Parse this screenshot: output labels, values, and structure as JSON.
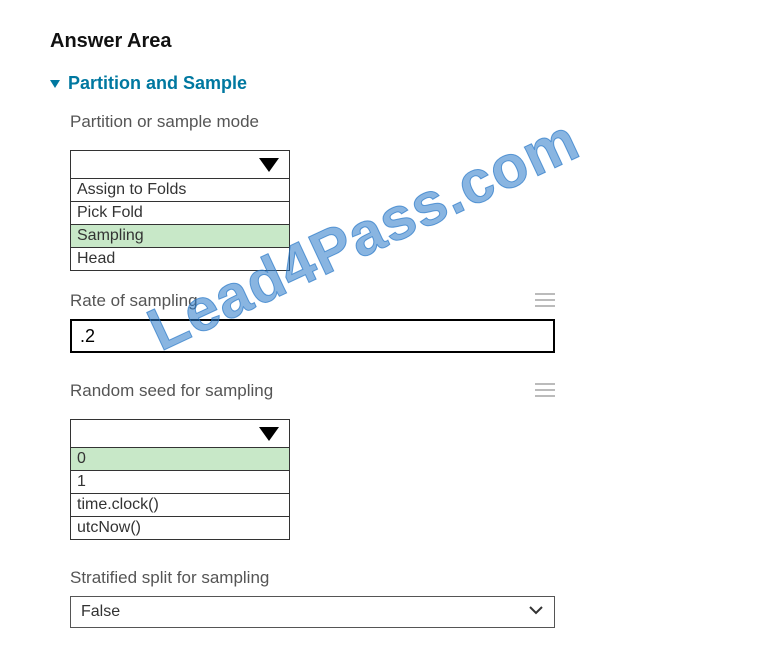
{
  "title": "Answer Area",
  "section": {
    "header": "Partition and Sample"
  },
  "mode": {
    "label": "Partition or sample mode",
    "options": [
      "Assign to Folds",
      "Pick Fold",
      "Sampling",
      "Head"
    ],
    "selected_index": 2
  },
  "rate": {
    "label": "Rate of sampling",
    "value": ".2"
  },
  "seed": {
    "label": "Random seed for sampling",
    "options": [
      "0",
      "1",
      "time.clock()",
      "utcNow()"
    ],
    "selected_index": 0
  },
  "stratified": {
    "label": "Stratified split for sampling",
    "value": "False"
  },
  "watermark": "Lead4Pass.com"
}
